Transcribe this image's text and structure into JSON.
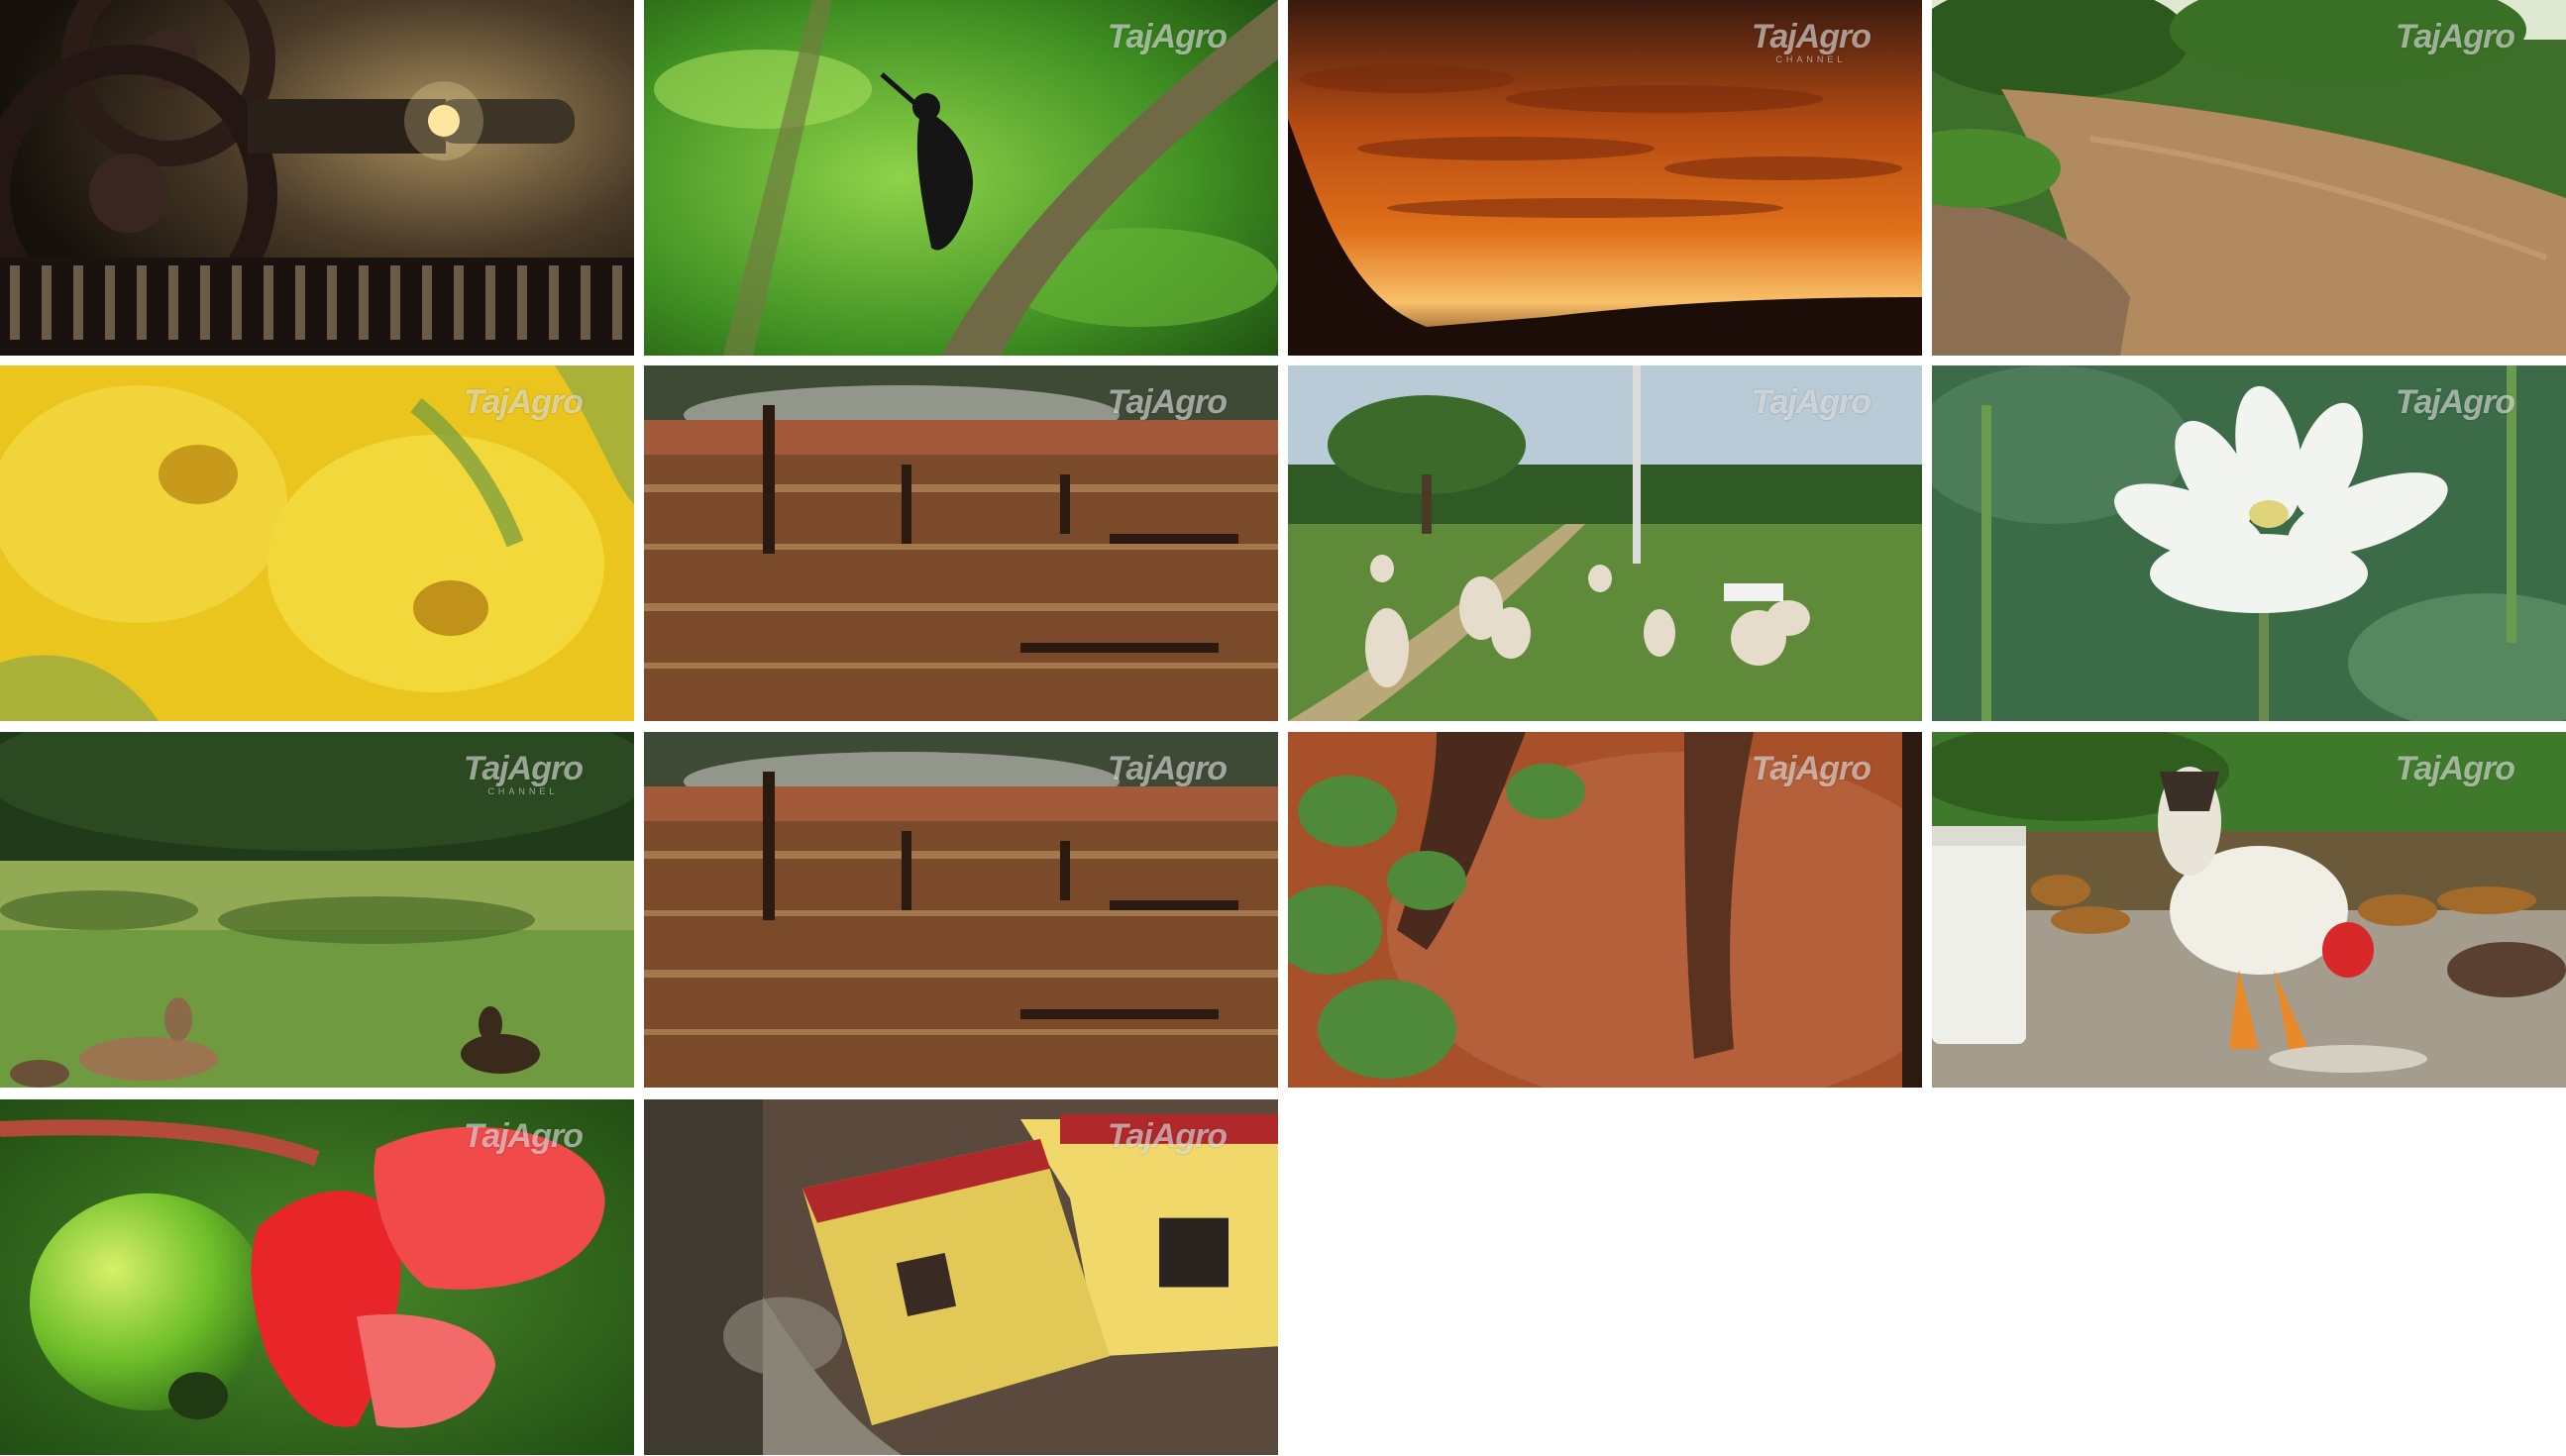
{
  "watermark": {
    "brand": "TajAgro",
    "sub": "CHANNEL"
  },
  "tiles": [
    {
      "icon": "film-reel-projector-icon"
    },
    {
      "icon": "bird-on-branch-icon"
    },
    {
      "icon": "sunset-sky-icon"
    },
    {
      "icon": "muddy-river-icon"
    },
    {
      "icon": "yellow-flowers-icon"
    },
    {
      "icon": "burnt-field-icon"
    },
    {
      "icon": "sheep-grazing-icon"
    },
    {
      "icon": "white-lotus-icon"
    },
    {
      "icon": "deer-in-grass-icon"
    },
    {
      "icon": "burnt-field-icon"
    },
    {
      "icon": "tree-trunk-soil-icon"
    },
    {
      "icon": "hen-feeding-icon"
    },
    {
      "icon": "cashew-fruit-icon"
    },
    {
      "icon": "collapsing-building-icon"
    }
  ]
}
